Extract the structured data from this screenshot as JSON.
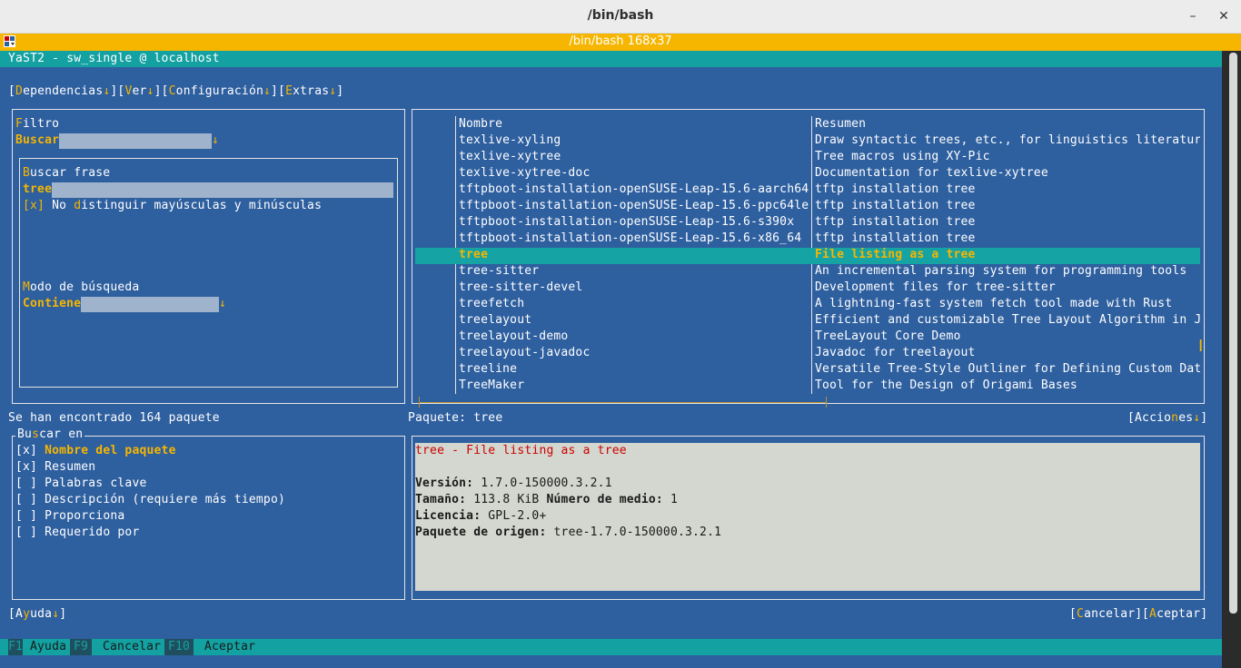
{
  "window": {
    "title": "/bin/bash",
    "minimize": "–",
    "close": "✕"
  },
  "konsole": {
    "title": "/bin/bash 168x37"
  },
  "yast": {
    "header": "YaST2 - sw_single @ localhost"
  },
  "menu": [
    {
      "pre": "[",
      "hot": "D",
      "rest": "ependencias",
      "arrow": "↓",
      "post": "]"
    },
    {
      "pre": "[",
      "hot": "V",
      "rest": "er",
      "arrow": "↓",
      "post": "]"
    },
    {
      "pre": "[",
      "hot": "C",
      "rest_pre": "",
      "rest": "onfiguración",
      "arrow": "↓",
      "post": "]"
    },
    {
      "pre": "[",
      "hot": "E",
      "rest_pre": "",
      "rest": "xtras",
      "arrow": "↓",
      "post": "]"
    }
  ],
  "filter": {
    "label_hot": "F",
    "label_rest": "iltro",
    "buscar_label": "Buscar",
    "arrow": "↓",
    "phrase_hot": "B",
    "phrase_rest": "uscar frase",
    "phrase_value": "tree",
    "case_check": "[x]",
    "case_pre": " No ",
    "case_hot": "d",
    "case_rest": "istinguir mayúsculas y minúsculas",
    "mode_hot": "M",
    "mode_rest": "odo de búsqueda",
    "mode_value": "Contiene"
  },
  "table": {
    "col_name": "Nombre",
    "col_summary": "Resumen",
    "rows": [
      {
        "name": "texlive-xyling",
        "summary": "Draw syntactic trees, etc., for linguistics literatur"
      },
      {
        "name": "texlive-xytree",
        "summary": "Tree macros using XY-Pic"
      },
      {
        "name": "texlive-xytree-doc",
        "summary": "Documentation for texlive-xytree"
      },
      {
        "name": "tftpboot-installation-openSUSE-Leap-15.6-aarch64",
        "summary": "tftp installation tree"
      },
      {
        "name": "tftpboot-installation-openSUSE-Leap-15.6-ppc64le",
        "summary": "tftp installation tree"
      },
      {
        "name": "tftpboot-installation-openSUSE-Leap-15.6-s390x",
        "summary": "tftp installation tree"
      },
      {
        "name": "tftpboot-installation-openSUSE-Leap-15.6-x86_64",
        "summary": "tftp installation tree"
      },
      {
        "name": "tree",
        "summary": "File listing as a tree"
      },
      {
        "name": "tree-sitter",
        "summary": "An incremental parsing system for programming tools"
      },
      {
        "name": "tree-sitter-devel",
        "summary": "Development files for tree-sitter"
      },
      {
        "name": "treefetch",
        "summary": "A lightning-fast system fetch tool made with Rust"
      },
      {
        "name": "treelayout",
        "summary": "Efficient and customizable Tree Layout Algorithm in J"
      },
      {
        "name": "treelayout-demo",
        "summary": "TreeLayout Core Demo"
      },
      {
        "name": "treelayout-javadoc",
        "summary": "Javadoc for treelayout"
      },
      {
        "name": "treeline",
        "summary": "Versatile Tree-Style Outliner for Defining Custom Dat"
      },
      {
        "name": "TreeMaker",
        "summary": "Tool for the Design of Origami Bases"
      }
    ]
  },
  "status": {
    "found": "Se han encontrado 164 paquete",
    "package_label": "Paquete: tree",
    "acciones_pre": "[Accio",
    "acciones_hot": "n",
    "acciones_rest": "es",
    "acciones_arrow": "↓",
    "acciones_post": "]"
  },
  "search_in": {
    "title_pre": "Bu",
    "title_hot": "s",
    "title_rest": "car en",
    "options": [
      {
        "check": "[x]",
        "label": "Nombre del paquete"
      },
      {
        "check": "[x]",
        "label": "Resumen"
      },
      {
        "check": "[ ]",
        "label": "Palabras clave"
      },
      {
        "check": "[ ]",
        "label": "Descripción (requiere más tiempo)"
      },
      {
        "check": "[ ]",
        "label": "Proporciona"
      },
      {
        "check": "[ ]",
        "label": "Requerido por"
      }
    ]
  },
  "details": {
    "heading": "tree - File listing as a tree",
    "version_label": "Versión:",
    "version": " 1.7.0-150000.3.2.1",
    "size_label": "Tamaño:",
    "size": " 113.8 KiB ",
    "media_label": "Número de medio:",
    "media": " 1",
    "license_label": "Licencia:",
    "license": " GPL-2.0+",
    "source_label": "Paquete de origen:",
    "source": " tree-1.7.0-150000.3.2.1"
  },
  "buttons": {
    "help_pre": "[A",
    "help_hot": "y",
    "help_rest": "uda",
    "help_arrow": "↓",
    "help_post": "]",
    "cancel_pre": "[",
    "cancel_hot": "C",
    "cancel_rest": "ancelar]",
    "accept_pre": "[",
    "accept_hot": "A",
    "accept_rest": "ceptar]"
  },
  "fkeys": [
    {
      "key": "F1",
      "label": "Ayuda"
    },
    {
      "key": "F9",
      "label": "Cancelar"
    },
    {
      "key": "F10",
      "label": "Aceptar"
    }
  ],
  "colors": {
    "terminal_bg": "#2e5f9f",
    "accent": "#f6b600",
    "selection": "#15a3a3",
    "details_bg": "#d3d7cf"
  }
}
